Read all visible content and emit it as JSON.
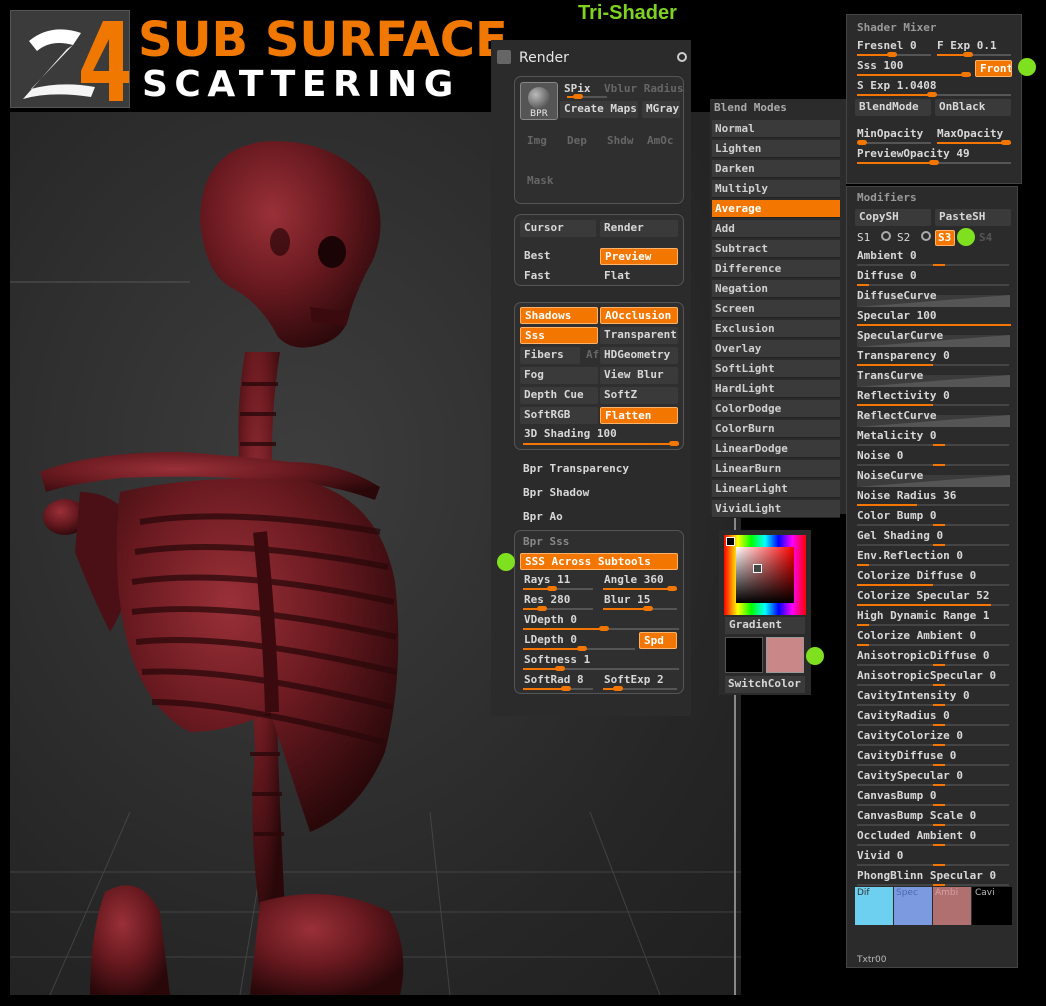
{
  "header": {
    "title_line1": "SUB SURFACE",
    "title_line2": "SCATTERING",
    "section_label": "Tri-Shader"
  },
  "render": {
    "title": "Render",
    "bpr_label": "BPR",
    "top_items": [
      "SPix",
      "Vblur Radius",
      "Create Maps",
      "MGray",
      "Img",
      "Dep",
      "Shdw",
      "AmOc",
      "Mask"
    ],
    "mode_items": [
      "Cursor",
      "Render",
      "Best",
      "Preview",
      "Fast",
      "Flat"
    ],
    "feature_items": [
      "Shadows",
      "AOcclusion",
      "Sss",
      "Transparent",
      "Fibers",
      "Af",
      "HDGeometry",
      "Fog",
      "View Blur",
      "Depth Cue",
      "SoftZ",
      "SoftRGB",
      "Flatten"
    ],
    "shading": "3D Shading 100",
    "bpr_sections": [
      "Bpr Transparency",
      "Bpr Shadow",
      "Bpr Ao"
    ],
    "sss": {
      "title": "Bpr Sss",
      "across": "SSS Across Subtools",
      "rays": "Rays 11",
      "angle": "Angle 360",
      "res": "Res 280",
      "blur": "Blur 15",
      "vdepth": "VDepth 0",
      "ldepth": "LDepth 0",
      "spd": "Spd",
      "softness": "Softness 1",
      "softrad": "SoftRad 8",
      "softexp": "SoftExp 2"
    }
  },
  "blend": {
    "title": "Blend Modes",
    "items": [
      "Normal",
      "Lighten",
      "Darken",
      "Multiply",
      "Average",
      "Add",
      "Subtract",
      "Difference",
      "Negation",
      "Screen",
      "Exclusion",
      "Overlay",
      "SoftLight",
      "HardLight",
      "ColorDodge",
      "ColorBurn",
      "LinearDodge",
      "LinearBurn",
      "LinearLight",
      "VividLight"
    ],
    "selected": "Average"
  },
  "color": {
    "gradient": "Gradient",
    "switch": "SwitchColor",
    "main_color": "#000000",
    "secondary_color": "#c98787"
  },
  "mixer": {
    "title": "Shader Mixer",
    "fresnel": "Fresnel 0",
    "fexp": "F Exp 0.1",
    "sss": "Sss 100",
    "front": "Front",
    "sexp": "S Exp 1.0408",
    "blendmode": "BlendMode",
    "onblack": "OnBlack",
    "minop": "MinOpacity",
    "maxop": "MaxOpacity",
    "preview": "PreviewOpacity 49"
  },
  "modifiers": {
    "title": "Modifiers",
    "copy": "CopySH",
    "paste": "PasteSH",
    "s1": "S1",
    "s2": "S2",
    "s3": "S3",
    "s4": "S4",
    "rows": [
      "Ambient 0",
      "Diffuse 0",
      "DiffuseCurve",
      "Specular 100",
      "SpecularCurve",
      "Transparency 0",
      "TransCurve",
      "Reflectivity 0",
      "ReflectCurve",
      "Metalicity 0",
      "Noise 0",
      "NoiseCurve",
      "Noise Radius 36",
      "Color Bump 0",
      "Gel Shading 0",
      "Env.Reflection 0",
      "Colorize Diffuse 0",
      "Colorize Specular 52",
      "High Dynamic Range 1",
      "Colorize Ambient 0",
      "AnisotropicDiffuse 0",
      "AnisotropicSpecular 0",
      "CavityIntensity 0",
      "CavityRadius 0",
      "CavityColorize 0",
      "CavityDiffuse 0",
      "CavitySpecular 0",
      "CanvasBump 0",
      "CanvasBump Scale 0",
      "Occluded  Ambient 0",
      "Vivid 0",
      "PhongBlinn Specular 0"
    ],
    "swatches": [
      "Dif",
      "Spec",
      "Ambi",
      "Cavi"
    ],
    "texture": "Txtr00"
  },
  "colors": {
    "accent": "#f27600",
    "indicator": "#7fe01f",
    "skeleton": "#6e1a20"
  }
}
